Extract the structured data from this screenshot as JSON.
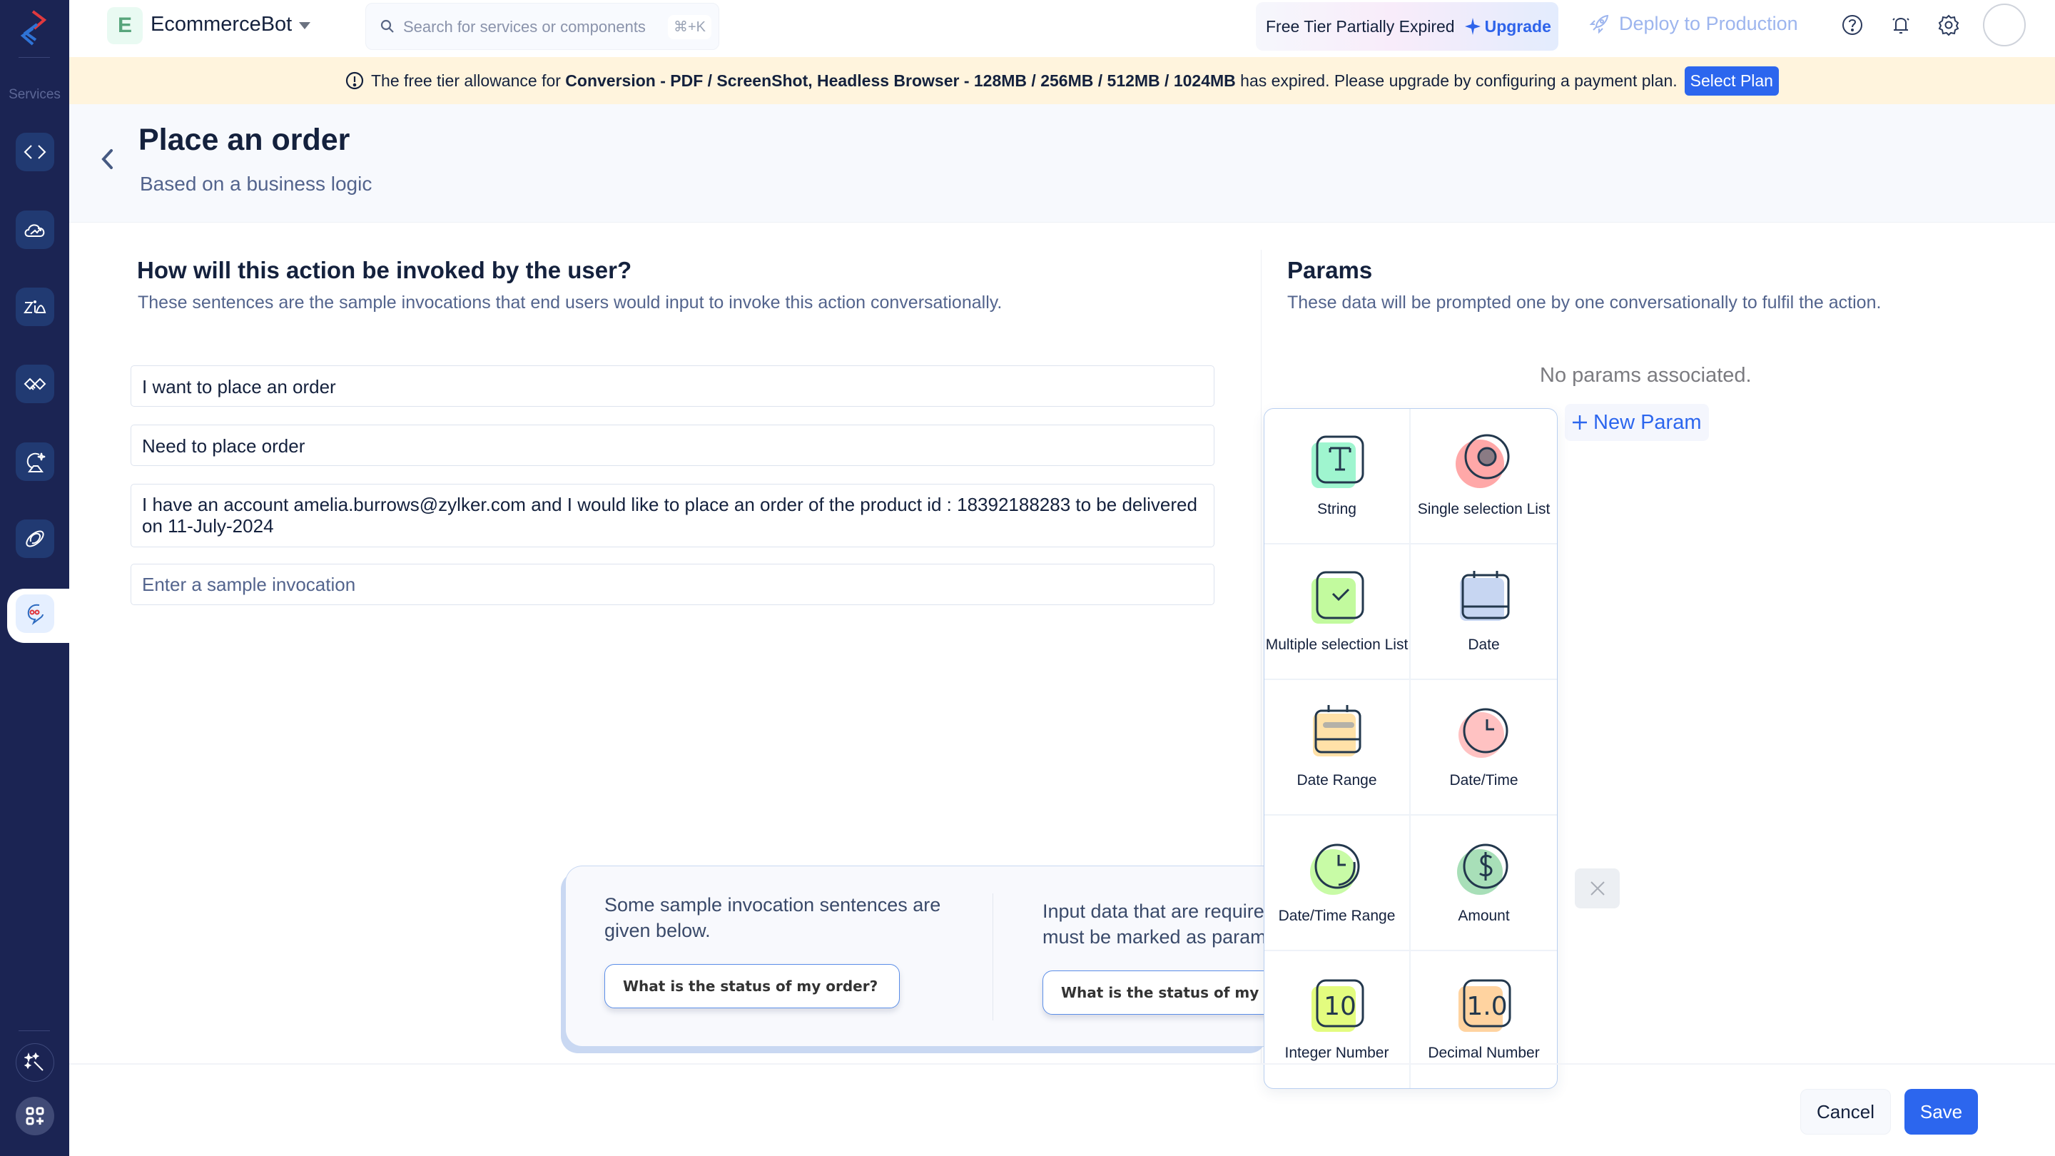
{
  "app": {
    "org_initial": "E",
    "org_name": "EcommerceBot",
    "search_placeholder": "Search for services or components",
    "search_shortcut": "⌘+K",
    "tier_status": "Free Tier Partially Expired",
    "upgrade_label": "Upgrade",
    "deploy_label": "Deploy to Production",
    "icons": [
      "help-icon",
      "bell-icon",
      "gear-icon"
    ]
  },
  "sidebar": {
    "label": "Services",
    "items": [
      {
        "name": "functions",
        "icon": "code-icon"
      },
      {
        "name": "cloud-scale",
        "icon": "cloud-icon"
      },
      {
        "name": "zia",
        "icon": "zia-icon"
      },
      {
        "name": "integrations",
        "icon": "handshake-icon"
      },
      {
        "name": "quickml",
        "icon": "ai-icon"
      },
      {
        "name": "connections",
        "icon": "link-icon"
      },
      {
        "name": "convokraft",
        "icon": "chatbot-icon",
        "active": true
      }
    ],
    "bottom": [
      {
        "name": "ai-assist",
        "icon": "magic-wand-icon"
      },
      {
        "name": "add-services",
        "icon": "apps-add-icon"
      }
    ]
  },
  "banner": {
    "prefix": "The free tier allowance for ",
    "services": "Conversion - PDF / ScreenShot, Headless Browser - 128MB / 256MB / 512MB / 1024MB",
    "suffix": " has expired. Please upgrade by configuring a payment plan.",
    "button": "Select Plan"
  },
  "header": {
    "title": "Place an order",
    "subtitle": "Based on a business logic"
  },
  "invocations": {
    "title": "How will this action be invoked by the user?",
    "description": "These sentences are the sample invocations that end users would input to invoke this action conversationally.",
    "items": [
      "I want to place an order",
      "Need to place order",
      "I have an account amelia.burrows@zylker.com and I would like to place an order of the product id : 18392188283 to be delivered on 11-July-2024"
    ],
    "new_placeholder": "Enter a sample invocation"
  },
  "params": {
    "title": "Params",
    "description": "These data will be prompted one by one conversationally to fulfil the action.",
    "empty": "No params associated.",
    "new_param": "New Param",
    "types": [
      {
        "label": "String",
        "icon": "string-icon",
        "color": "#9ff5cf"
      },
      {
        "label": "Single selection List",
        "icon": "radio-icon",
        "color": "#ffa8a8"
      },
      {
        "label": "Multiple selection List",
        "icon": "checkbox-icon",
        "color": "#c2fa9e"
      },
      {
        "label": "Date",
        "icon": "calendar-icon",
        "color": "#c7d6f2"
      },
      {
        "label": "Date Range",
        "icon": "date-range-icon",
        "color": "#ffe1a8"
      },
      {
        "label": "Date/Time",
        "icon": "clock-icon",
        "color": "#ffc2c2"
      },
      {
        "label": "Date/Time Range",
        "icon": "clock-range-icon",
        "color": "#c8fba6"
      },
      {
        "label": "Amount",
        "icon": "dollar-icon",
        "color": "#a8dfb8"
      },
      {
        "label": "Integer Number",
        "icon": "integer-icon",
        "color": "#e3fc7f"
      },
      {
        "label": "Decimal Number",
        "icon": "decimal-icon",
        "color": "#ffd3a0"
      }
    ]
  },
  "info_card": {
    "left_text": "Some sample invocation sentences are given below.",
    "left_example": "What is the status of my order?",
    "right_text": "Input data that are required to fulfil the action must be marked as params in",
    "right_example": "What is the status of my order?"
  },
  "footer": {
    "cancel": "Cancel",
    "save": "Save"
  },
  "colors": {
    "sidebar": "#1b2453",
    "accent": "#2c66ee",
    "banner": "#fff4dd"
  }
}
